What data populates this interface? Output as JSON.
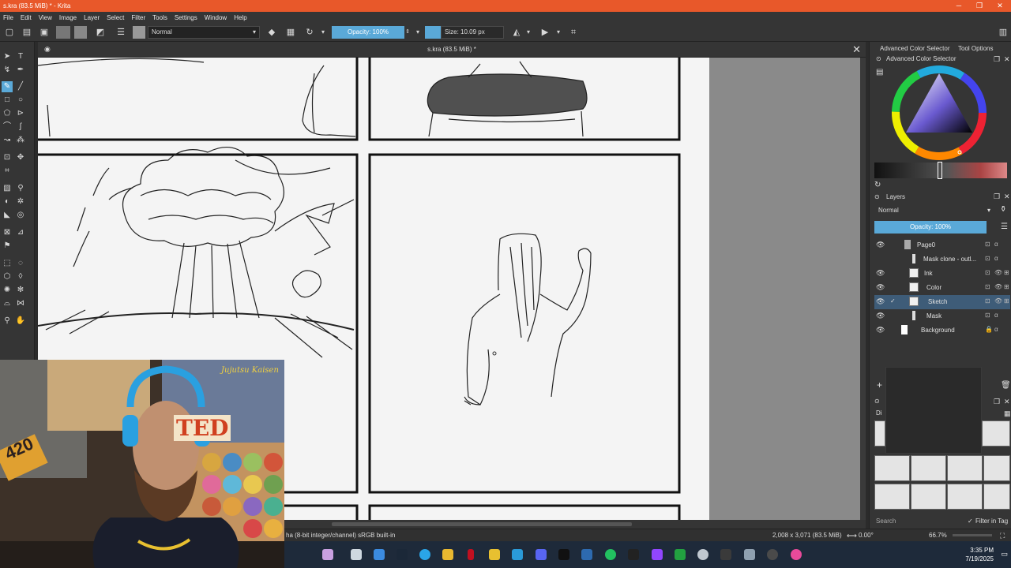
{
  "window": {
    "title": "s.kra (83.5 MiB) * - Krita",
    "doc_title": "s.kra (83.5 MiB) *"
  },
  "menu": [
    "File",
    "Edit",
    "View",
    "Image",
    "Layer",
    "Select",
    "Filter",
    "Tools",
    "Settings",
    "Window",
    "Help"
  ],
  "toolbar": {
    "blend_mode": "Normal",
    "opacity_label": "Opacity: 100%",
    "size_label": "Size: 10.09 px"
  },
  "dock": {
    "tab_color_selector": "Advanced Color Selector",
    "tab_tool_options": "Tool Options",
    "color_selector_title": "Advanced Color Selector",
    "layers_title": "Layers",
    "layers_blend_mode": "Normal",
    "layers_opacity": "Opacity: 100%",
    "layers": [
      {
        "name": "Page0"
      },
      {
        "name": "Mask clone - outl..."
      },
      {
        "name": "Ink"
      },
      {
        "name": "Color"
      },
      {
        "name": "Sketch"
      },
      {
        "name": "Mask"
      },
      {
        "name": "Background"
      }
    ],
    "brush_search_placeholder": "Search",
    "filter_in_tag": "Filter in Tag",
    "brush_presets_short": "Di"
  },
  "status": {
    "color_info": "ha (8-bit integer/channel)  sRGB built-in",
    "dimensions": "2,008 x 3,071 (83.5 MiB)",
    "rotation": "0.00°",
    "zoom": "66.7%"
  },
  "webcam": {
    "poster_text": "Jujutsu Kaisen",
    "sign_text": "TED",
    "badge_text": "420"
  },
  "taskbar": {
    "time": "3:35 PM",
    "date": "7/19/2025"
  },
  "colors": {
    "titlebar": "#e8582a",
    "accent_blue": "#5aa9d8",
    "panel_bg": "#353535"
  }
}
